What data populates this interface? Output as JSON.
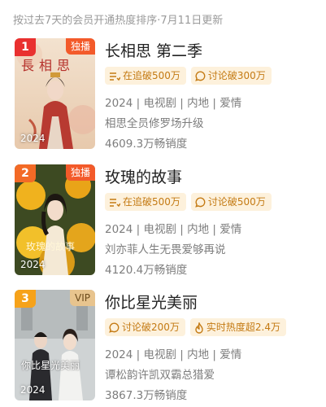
{
  "header": {
    "note": "按过去7天的会员开通热度排序·7月11日更新"
  },
  "colors": {
    "rank1": "#e9302f",
    "rank2": "#f36a26",
    "rank3": "#f6a21a",
    "exclusive_tag": "#f35a2a",
    "vip_tag": "#e8c48e",
    "badge_bg": "#fdf1dc",
    "badge_text": "#c47a13"
  },
  "items": [
    {
      "rank": "1",
      "tag": "独播",
      "year": "2024",
      "title": "长相思 第二季",
      "badges": [
        {
          "icon": "list-icon",
          "text": "在追破500万"
        },
        {
          "icon": "chat-bubble-icon",
          "text": "讨论破300万"
        }
      ],
      "meta": "2024 | 电视剧 | 内地 | 爱情",
      "tagline": "相思全员修罗场升级",
      "sales": "4609.3万畅销度",
      "poster_text": "長相思"
    },
    {
      "rank": "2",
      "tag": "独播",
      "year": "2024",
      "title": "玫瑰的故事",
      "badges": [
        {
          "icon": "list-icon",
          "text": "在追破500万"
        },
        {
          "icon": "chat-bubble-icon",
          "text": "讨论破500万"
        }
      ],
      "meta": "2024 | 电视剧 | 内地 | 爱情",
      "tagline": "刘亦菲人生无畏爱够再说",
      "sales": "4120.4万畅销度",
      "poster_text": "玫瑰的故事"
    },
    {
      "rank": "3",
      "tag": "VIP",
      "year": "2024",
      "title": "你比星光美丽",
      "badges": [
        {
          "icon": "chat-bubble-icon",
          "text": "讨论破200万"
        },
        {
          "icon": "flame-icon",
          "text": "实时热度超2.4万"
        }
      ],
      "meta": "2024 | 电视剧 | 内地 | 爱情",
      "tagline": "谭松韵许凯双霸总猎爱",
      "sales": "3867.3万畅销度",
      "poster_text": "你比星光美丽"
    }
  ]
}
